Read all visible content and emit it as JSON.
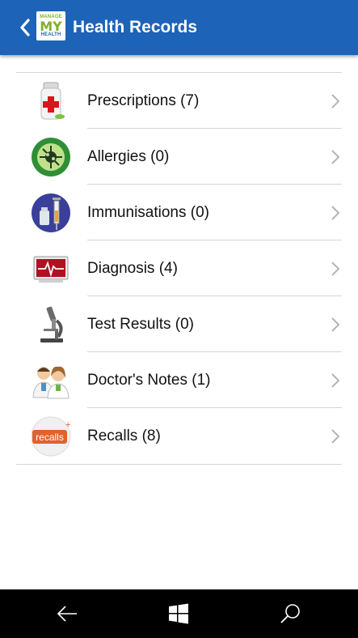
{
  "header": {
    "title": "Health Records",
    "logo": {
      "line1": "MANAGE",
      "line2": "MY",
      "line3": "HEALTH"
    },
    "back_icon": "chevron-left-icon"
  },
  "records": [
    {
      "label": "Prescriptions (7)",
      "icon": "pill-bottle-icon"
    },
    {
      "label": "Allergies (0)",
      "icon": "allergy-icon"
    },
    {
      "label": "Immunisations (0)",
      "icon": "syringe-icon"
    },
    {
      "label": "Diagnosis (4)",
      "icon": "heart-monitor-icon"
    },
    {
      "label": "Test Results (0)",
      "icon": "microscope-icon"
    },
    {
      "label": "Doctor's Notes (1)",
      "icon": "doctors-icon"
    },
    {
      "label": "Recalls (8)",
      "icon": "recalls-icon",
      "icon_text": "recalls"
    }
  ],
  "navbar": {
    "back_icon": "arrow-left-icon",
    "home_icon": "windows-logo-icon",
    "search_icon": "search-icon"
  },
  "colors": {
    "header_bg": "#1d63b8",
    "brand_green": "#7fb12a",
    "navbar_bg": "#000000"
  }
}
